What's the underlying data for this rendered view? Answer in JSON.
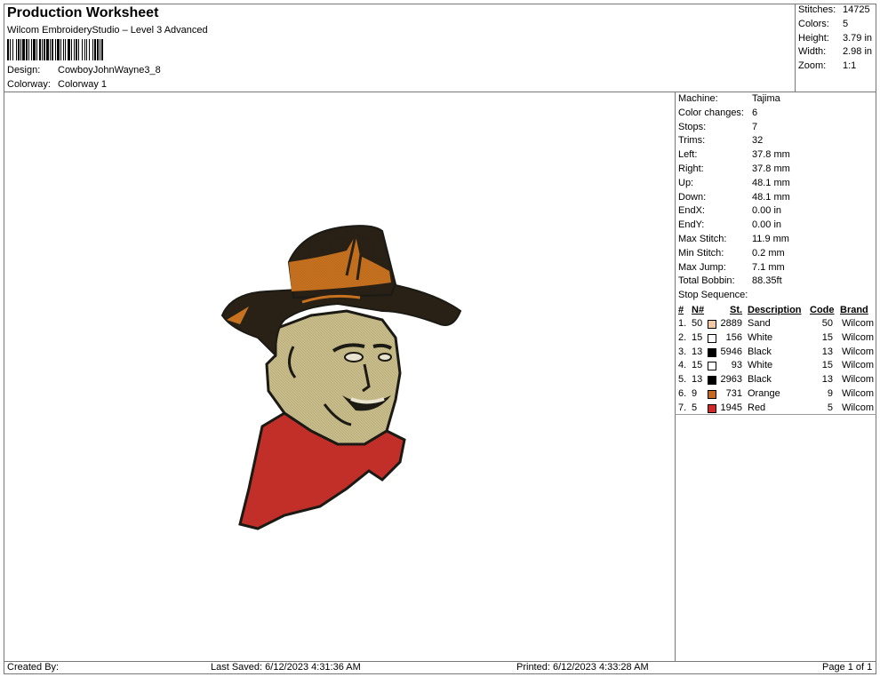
{
  "header": {
    "title": "Production Worksheet",
    "software": "Wilcom EmbroideryStudio – Level 3 Advanced",
    "design_label": "Design:",
    "design_value": "CowboyJohnWayne3_8",
    "colorway_label": "Colorway:",
    "colorway_value": "Colorway 1"
  },
  "summary": [
    {
      "label": "Stitches:",
      "value": "14725"
    },
    {
      "label": "Colors:",
      "value": "5"
    },
    {
      "label": "Height:",
      "value": "3.79 in"
    },
    {
      "label": "Width:",
      "value": "2.98 in"
    },
    {
      "label": "Zoom:",
      "value": "1:1"
    }
  ],
  "machine_info": [
    {
      "label": "Machine:",
      "value": "Tajima"
    },
    {
      "label": "Color changes:",
      "value": "6"
    },
    {
      "label": "Stops:",
      "value": "7"
    },
    {
      "label": "Trims:",
      "value": "32"
    },
    {
      "label": "Left:",
      "value": "37.8 mm"
    },
    {
      "label": "Right:",
      "value": "37.8 mm"
    },
    {
      "label": "Up:",
      "value": "48.1 mm"
    },
    {
      "label": "Down:",
      "value": "48.1 mm"
    },
    {
      "label": "EndX:",
      "value": "0.00 in"
    },
    {
      "label": "EndY:",
      "value": "0.00 in"
    },
    {
      "label": "Max Stitch:",
      "value": "11.9 mm"
    },
    {
      "label": "Min Stitch:",
      "value": "0.2 mm"
    },
    {
      "label": "Max Jump:",
      "value": "7.1 mm"
    },
    {
      "label": "Total Bobbin:",
      "value": "88.35ft"
    }
  ],
  "stop_sequence": {
    "title": "Stop Sequence:",
    "headers": {
      "num": "#",
      "n": "N#",
      "st": "St.",
      "desc": "Description",
      "code": "Code",
      "brand": "Brand"
    },
    "rows": [
      {
        "idx": "1.",
        "n": "50",
        "color": "#f3c9a1",
        "st": "2889",
        "desc": "Sand",
        "code": "50",
        "brand": "Wilcom"
      },
      {
        "idx": "2.",
        "n": "15",
        "color": "#ffffff",
        "st": "156",
        "desc": "White",
        "code": "15",
        "brand": "Wilcom"
      },
      {
        "idx": "3.",
        "n": "13",
        "color": "#000000",
        "st": "5946",
        "desc": "Black",
        "code": "13",
        "brand": "Wilcom"
      },
      {
        "idx": "4.",
        "n": "15",
        "color": "#ffffff",
        "st": "93",
        "desc": "White",
        "code": "15",
        "brand": "Wilcom"
      },
      {
        "idx": "5.",
        "n": "13",
        "color": "#000000",
        "st": "2963",
        "desc": "Black",
        "code": "13",
        "brand": "Wilcom"
      },
      {
        "idx": "6.",
        "n": "9",
        "color": "#c86a1e",
        "st": "731",
        "desc": "Orange",
        "code": "9",
        "brand": "Wilcom"
      },
      {
        "idx": "7.",
        "n": "5",
        "color": "#d42828",
        "st": "1945",
        "desc": "Red",
        "code": "5",
        "brand": "Wilcom"
      }
    ]
  },
  "footer": {
    "created_by": "Created By:",
    "last_saved": "Last Saved: 6/12/2023 4:31:36 AM",
    "printed": "Printed: 6/12/2023 4:33:28 AM",
    "page": "Page 1 of 1"
  },
  "design_preview": {
    "icon": "cowboy-embroidery-image",
    "colors": {
      "hat": "#2a2116",
      "hat_band": "#c8721f",
      "face": "#c9bd8a",
      "bandana": "#c8302a",
      "outline": "#1b1a14"
    }
  }
}
